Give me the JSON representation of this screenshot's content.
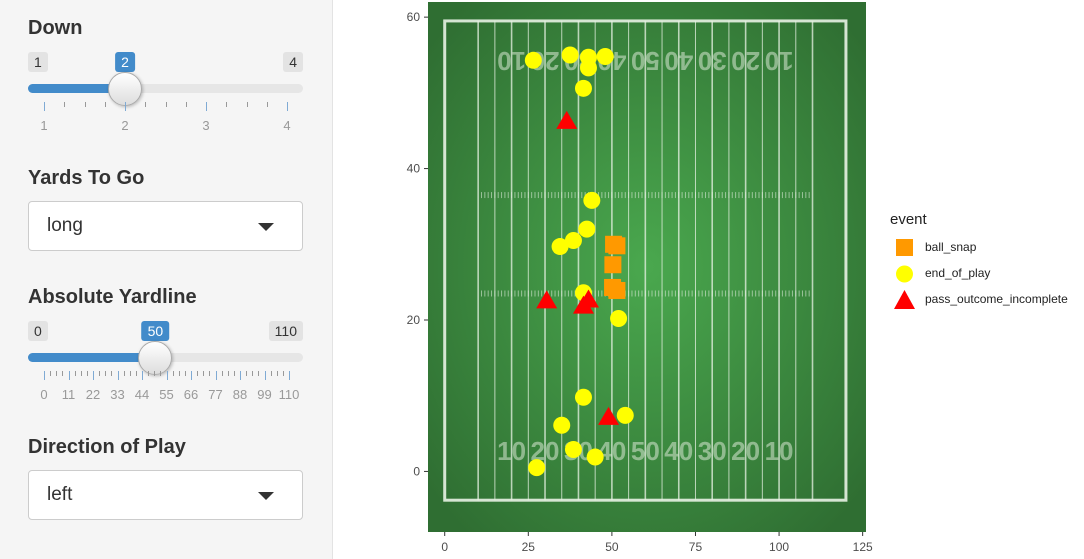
{
  "sidebar": {
    "down": {
      "label": "Down",
      "min": "1",
      "max": "4",
      "value": "2",
      "value_num": 2,
      "min_num": 1,
      "max_num": 4,
      "major_ticks": [
        "1",
        "2",
        "3",
        "4"
      ],
      "minor_per_gap": 3
    },
    "yards_to_go": {
      "label": "Yards To Go",
      "selected": "long"
    },
    "absolute_yardline": {
      "label": "Absolute Yardline",
      "min": "0",
      "max": "110",
      "value": "50",
      "value_num": 50,
      "min_num": 0,
      "max_num": 110,
      "major_ticks": [
        "0",
        "11",
        "22",
        "33",
        "44",
        "55",
        "66",
        "77",
        "88",
        "99",
        "110"
      ],
      "minor_per_gap": 3
    },
    "direction": {
      "label": "Direction of Play",
      "selected": "left"
    }
  },
  "colors": {
    "accent": "#428bca",
    "ball_snap": "#ff9900",
    "end_of_play": "#ffff00",
    "pass_outcome_incomplete": "#ff0000",
    "turf_dark": "#2f6e32",
    "turf_light": "#4aa84e"
  },
  "chart_data": {
    "type": "scatter",
    "x_ticks": [
      "0",
      "25",
      "50",
      "75",
      "100",
      "125"
    ],
    "y_ticks": [
      "0",
      "20",
      "40",
      "60"
    ],
    "xlim": [
      -5,
      126
    ],
    "ylim": [
      -8,
      62
    ],
    "background": "football-field-image",
    "field_numbers_top": [
      "10",
      "20",
      "30",
      "40",
      "50",
      "40",
      "30",
      "20",
      "10"
    ],
    "field_numbers_bottom": [
      "10",
      "20",
      "30",
      "40",
      "50",
      "40",
      "30",
      "20",
      "10"
    ],
    "legend": {
      "title": "event",
      "entries": [
        {
          "key": "ball_snap",
          "label": "ball_snap",
          "shape": "square"
        },
        {
          "key": "end_of_play",
          "label": "end_of_play",
          "shape": "circle"
        },
        {
          "key": "pass_outcome_incomplete",
          "label": "pass_outcome_incomplete",
          "shape": "triangle"
        }
      ]
    },
    "series": [
      {
        "name": "ball_snap",
        "shape": "square",
        "points": [
          [
            50.5,
            30
          ],
          [
            51.5,
            29.8
          ],
          [
            50.3,
            27.3
          ],
          [
            50.2,
            24.3
          ],
          [
            51.5,
            23.9
          ]
        ]
      },
      {
        "name": "end_of_play",
        "shape": "circle",
        "points": [
          [
            26.5,
            54.3
          ],
          [
            37.5,
            55
          ],
          [
            43,
            54.7
          ],
          [
            48,
            54.8
          ],
          [
            43,
            53.3
          ],
          [
            41.5,
            50.6
          ],
          [
            44,
            35.8
          ],
          [
            42.5,
            32
          ],
          [
            38.5,
            30.5
          ],
          [
            34.5,
            29.7
          ],
          [
            41.5,
            23.6
          ],
          [
            52,
            20.2
          ],
          [
            41.5,
            9.8
          ],
          [
            35,
            6.1
          ],
          [
            54,
            7.4
          ],
          [
            38.5,
            2.9
          ],
          [
            45,
            1.9
          ],
          [
            27.5,
            0.5
          ]
        ]
      },
      {
        "name": "pass_outcome_incomplete",
        "shape": "triangle",
        "points": [
          [
            36.5,
            46.3
          ],
          [
            30.5,
            22.6
          ],
          [
            41.5,
            21.9
          ],
          [
            43,
            22.7
          ],
          [
            49,
            7.2
          ]
        ]
      }
    ]
  }
}
